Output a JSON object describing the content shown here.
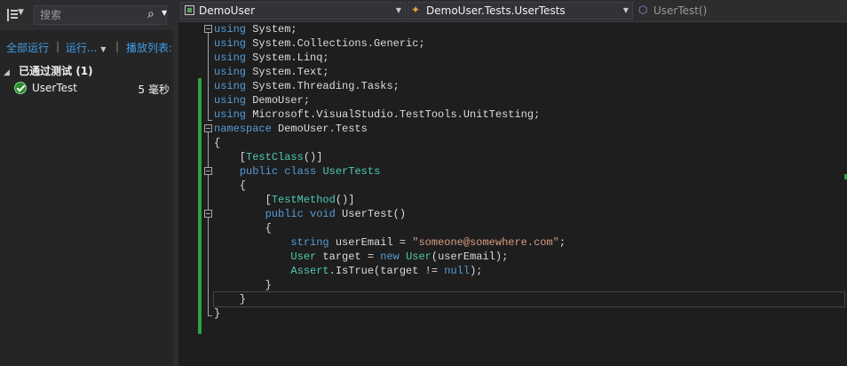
{
  "test_explorer": {
    "search": {
      "placeholder": "搜索",
      "value": ""
    },
    "actions": {
      "run_all": "全部运行",
      "run": "运行...",
      "playlist": "播放列表:"
    },
    "group": {
      "label": "已通过测试",
      "count": "(1)"
    },
    "tests": [
      {
        "name": "UserTest",
        "duration": "5 毫秒",
        "status": "passed"
      }
    ],
    "icons": [
      "group-by-icon",
      "search-icon",
      "passed-check-icon",
      "expand-triangle-icon"
    ]
  },
  "editor": {
    "navigation": {
      "project": "DemoUser",
      "type": "DemoUser.Tests.UserTests",
      "member": "UserTest()"
    },
    "code_lines": [
      [
        [
          "kw",
          "using"
        ],
        [
          "pl",
          " System;"
        ]
      ],
      [
        [
          "kw",
          "using"
        ],
        [
          "pl",
          " System.Collections.Generic;"
        ]
      ],
      [
        [
          "kw",
          "using"
        ],
        [
          "pl",
          " System.Linq;"
        ]
      ],
      [
        [
          "kw",
          "using"
        ],
        [
          "pl",
          " System.Text;"
        ]
      ],
      [
        [
          "kw",
          "using"
        ],
        [
          "pl",
          " System.Threading.Tasks;"
        ]
      ],
      [
        [
          "kw",
          "using"
        ],
        [
          "pl",
          " DemoUser;"
        ]
      ],
      [
        [
          "kw",
          "using"
        ],
        [
          "pl",
          " Microsoft.VisualStudio.TestTools.UnitTesting;"
        ]
      ],
      [
        [
          "kw",
          "namespace"
        ],
        [
          "pl",
          " DemoUser.Tests"
        ]
      ],
      [
        [
          "pl",
          "{"
        ]
      ],
      [
        [
          "pl",
          "    ["
        ],
        [
          "ty",
          "TestClass"
        ],
        [
          "pl",
          "()]"
        ]
      ],
      [
        [
          "pl",
          "    "
        ],
        [
          "kw",
          "public"
        ],
        [
          "pl",
          " "
        ],
        [
          "kw",
          "class"
        ],
        [
          "pl",
          " "
        ],
        [
          "ty",
          "UserTests"
        ]
      ],
      [
        [
          "pl",
          "    {"
        ]
      ],
      [
        [
          "pl",
          "        ["
        ],
        [
          "ty",
          "TestMethod"
        ],
        [
          "pl",
          "()]"
        ]
      ],
      [
        [
          "pl",
          "        "
        ],
        [
          "kw",
          "public"
        ],
        [
          "pl",
          " "
        ],
        [
          "kw",
          "void"
        ],
        [
          "pl",
          " UserTest()"
        ]
      ],
      [
        [
          "pl",
          "        {"
        ]
      ],
      [
        [
          "pl",
          "            "
        ],
        [
          "kw",
          "string"
        ],
        [
          "pl",
          " userEmail = "
        ],
        [
          "str",
          "\"someone@somewhere.com\""
        ],
        [
          "pl",
          ";"
        ]
      ],
      [
        [
          "pl",
          "            "
        ],
        [
          "ty",
          "User"
        ],
        [
          "pl",
          " target = "
        ],
        [
          "kw",
          "new"
        ],
        [
          "pl",
          " "
        ],
        [
          "ty",
          "User"
        ],
        [
          "pl",
          "(userEmail);"
        ]
      ],
      [
        [
          "pl",
          "            "
        ],
        [
          "ty",
          "Assert"
        ],
        [
          "pl",
          ".IsTrue(target != "
        ],
        [
          "kw",
          "null"
        ],
        [
          "pl",
          ");"
        ]
      ],
      [
        [
          "pl",
          "        }"
        ]
      ],
      [
        [
          "pl",
          "    }"
        ]
      ],
      [
        [
          "pl",
          "}"
        ]
      ]
    ],
    "current_line_index": 19,
    "colors": {
      "keyword": "#569cd6",
      "type": "#4ec9b0",
      "string": "#d69d85",
      "plain": "#dcdcdc",
      "change_bar": "#2ea043",
      "background": "#1e1e1e"
    }
  }
}
